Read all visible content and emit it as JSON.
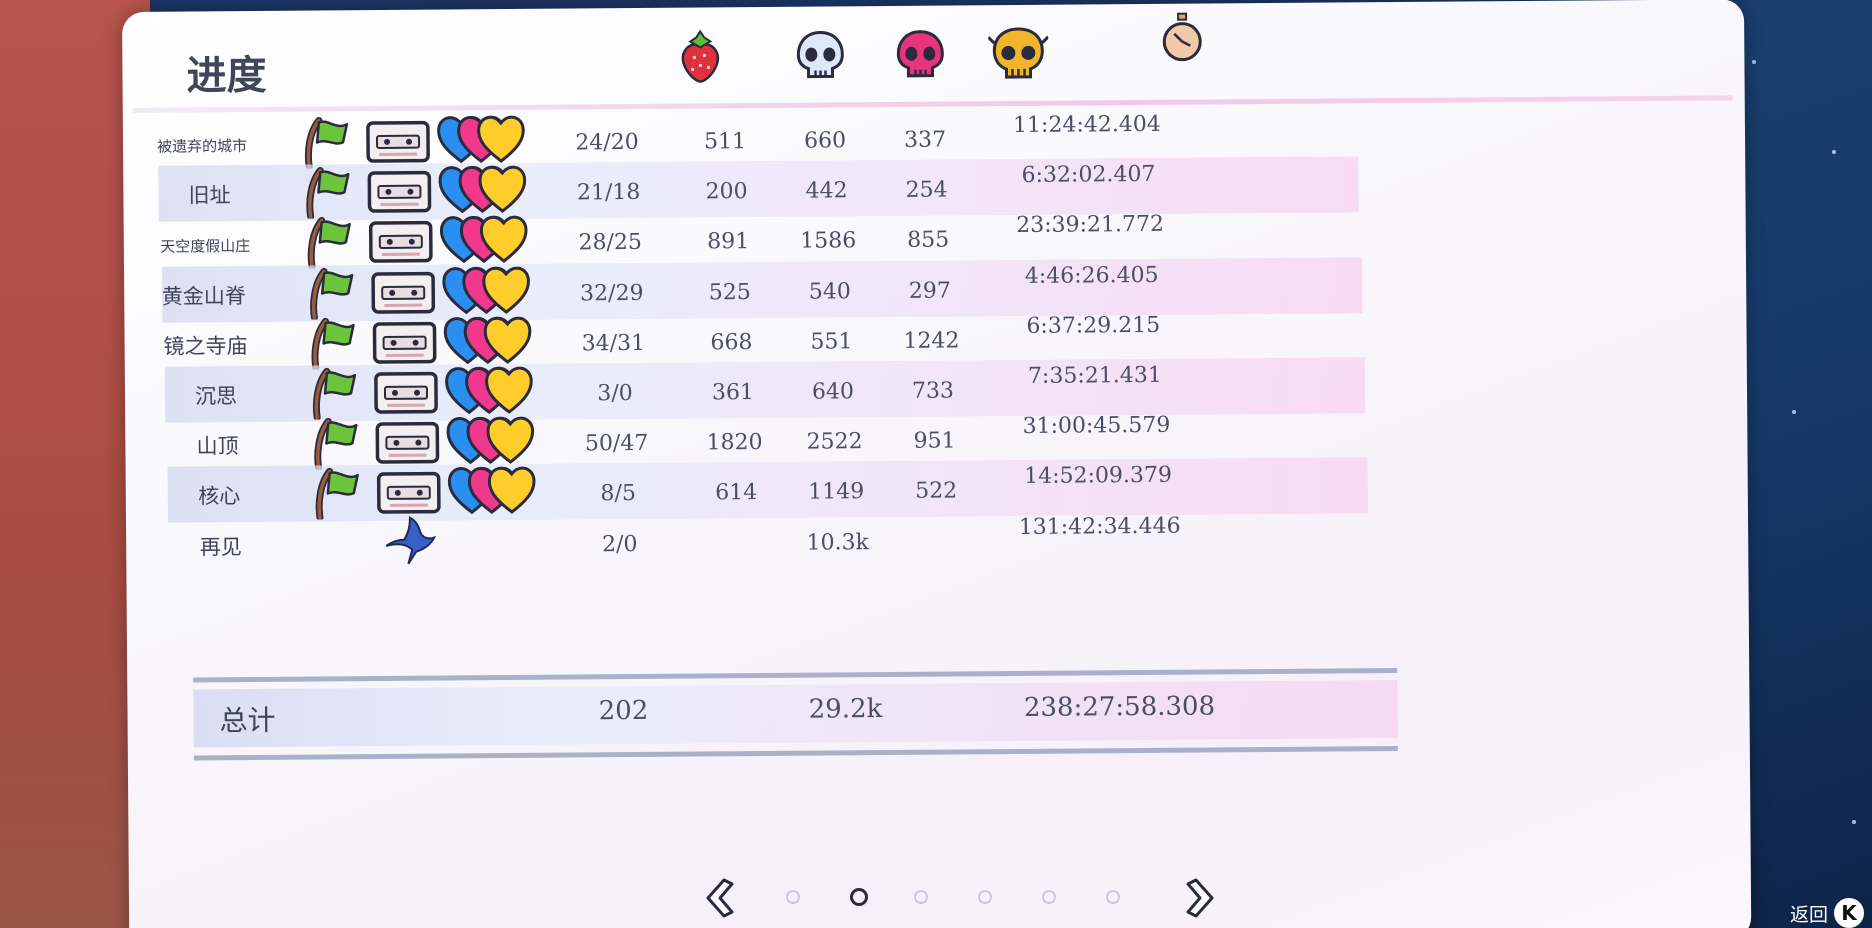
{
  "page": {
    "title": "进度",
    "back_label": "返回",
    "back_key": "K"
  },
  "header_icons": [
    "strawberry-icon",
    "skull-icon",
    "pink-skull-icon",
    "golden-skull-icon",
    "stopwatch-icon"
  ],
  "chapters": [
    {
      "name": "被遗弃的城市",
      "strawberries": "24/20",
      "deaths_a": "511",
      "deaths_b": "660",
      "deaths_c": "337",
      "time": "11:24:42.404"
    },
    {
      "name": "旧址",
      "strawberries": "21/18",
      "deaths_a": "200",
      "deaths_b": "442",
      "deaths_c": "254",
      "time": "6:32:02.407"
    },
    {
      "name": "天空度假山庄",
      "strawberries": "28/25",
      "deaths_a": "891",
      "deaths_b": "1586",
      "deaths_c": "855",
      "time": "23:39:21.772"
    },
    {
      "name": "黄金山脊",
      "strawberries": "32/29",
      "deaths_a": "525",
      "deaths_b": "540",
      "deaths_c": "297",
      "time": "4:46:26.405"
    },
    {
      "name": "镜之寺庙",
      "strawberries": "34/31",
      "deaths_a": "668",
      "deaths_b": "551",
      "deaths_c": "1242",
      "time": "6:37:29.215"
    },
    {
      "name": "沉思",
      "strawberries": "3/0",
      "deaths_a": "361",
      "deaths_b": "640",
      "deaths_c": "733",
      "time": "7:35:21.431"
    },
    {
      "name": "山顶",
      "strawberries": "50/47",
      "deaths_a": "1820",
      "deaths_b": "2522",
      "deaths_c": "951",
      "time": "31:00:45.579"
    },
    {
      "name": "核心",
      "strawberries": "8/5",
      "deaths_a": "614",
      "deaths_b": "1149",
      "deaths_c": "522",
      "time": "14:52:09.379"
    },
    {
      "name": "再见",
      "strawberries": "2/0",
      "deaths_a": "",
      "deaths_b": "10.3k",
      "deaths_c": "",
      "time": "131:42:34.446"
    }
  ],
  "totals": {
    "label": "总计",
    "strawberries": "202",
    "deaths": "29.2k",
    "time": "238:27:58.308"
  },
  "pagination": {
    "pages": 6,
    "active_index": 1
  },
  "colors": {
    "strawberry": "#e0313f",
    "skull_blue": "#a8c6f5",
    "skull_pink": "#e8347a",
    "skull_gold": "#f2b52a",
    "heart_blue": "#2a8ff0",
    "heart_pink": "#f0388c",
    "heart_gold": "#ffcd2a",
    "flag_green": "#6cc43a"
  }
}
